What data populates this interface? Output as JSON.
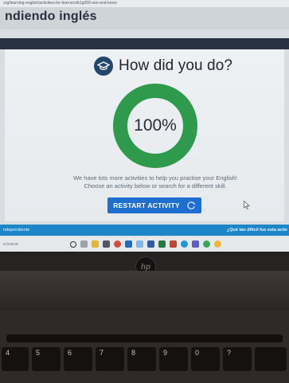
{
  "browser": {
    "url": "org/learning-english/activities-for-learners/b1g059-see-and-know"
  },
  "site": {
    "title": "ndiendo inglés"
  },
  "result": {
    "heading": "How did you do?",
    "score_label": "100%",
    "score_fraction": 1.0,
    "message_line1": "We have lots more activities to help you practise your English!",
    "message_line2": "Choose an activity below or search for a different skill.",
    "restart_label": "RESTART ACTIVITY"
  },
  "footer": {
    "left_text": "ndependiente",
    "right_text": "¿Qué tan difícil fue esta activ"
  },
  "taskbar": {
    "search_text": "a buscar"
  },
  "colors": {
    "donut_green": "#2e9a4b",
    "button_blue": "#1f6fd1",
    "footer_blue": "#1d86c9",
    "icon_navy": "#23476c"
  },
  "keyboard": {
    "keys": [
      "4",
      "5",
      "6",
      "7",
      "8",
      "9",
      "0",
      "?"
    ]
  }
}
